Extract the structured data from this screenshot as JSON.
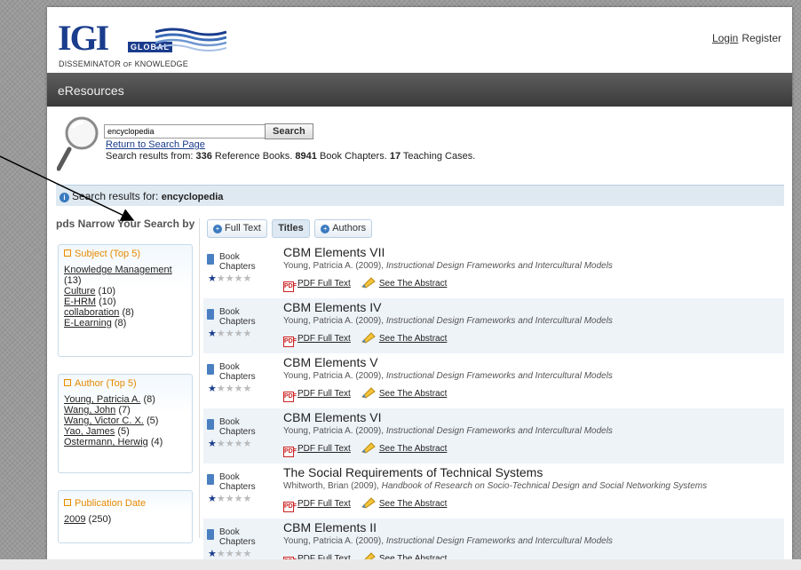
{
  "header": {
    "logo_word": "IGI",
    "logo_global": "GLOBAL",
    "logo_tag_a": "DISSEMINATOR",
    "logo_tag_of": "OF",
    "logo_tag_b": "KNOWLEDGE",
    "login": "Login",
    "register": "Register"
  },
  "nav": {
    "title": "eResources"
  },
  "search": {
    "value": "encyclopedia",
    "button": "Search",
    "return_link": "Return to Search Page",
    "summary_prefix": "Search results from: ",
    "ref_books_count": "336",
    "ref_books_label": " Reference Books. ",
    "chapters_count": "8941",
    "chapters_label": " Book Chapters. ",
    "cases_count": "17",
    "cases_label": " Teaching Cases."
  },
  "results_header": {
    "label": "Search results for: ",
    "term": "encyclopedia"
  },
  "sidebar": {
    "title": "pds Narrow Your Search by",
    "facets": [
      {
        "title": "Subject (Top 5)",
        "items": [
          {
            "link": "Knowledge Management",
            "count": "(13)"
          },
          {
            "link": "Culture",
            "count": "(10)"
          },
          {
            "link": "E-HRM",
            "count": "(10)"
          },
          {
            "link": "collaboration",
            "count": "(8)"
          },
          {
            "link": "E-Learning",
            "count": "(8)"
          }
        ]
      },
      {
        "title": "Author (Top 5)",
        "items": [
          {
            "link": "Young, Patricia A.",
            "count": "(8)"
          },
          {
            "link": "Wang, John",
            "count": "(7)"
          },
          {
            "link": "Wang, Victor C. X.",
            "count": "(5)"
          },
          {
            "link": "Yao, James",
            "count": "(5)"
          },
          {
            "link": "Ostermann, Herwig",
            "count": "(4)"
          }
        ]
      },
      {
        "title": "Publication Date",
        "items": [
          {
            "link": "2009",
            "count": "(250)"
          }
        ]
      }
    ]
  },
  "tabs": [
    {
      "label": "Full Text",
      "icon": "plus-circle-icon"
    },
    {
      "label": "Titles",
      "active": true
    },
    {
      "label": "Authors",
      "icon": "plus-circle-icon"
    }
  ],
  "results": [
    {
      "type": "Book Chapters",
      "rating": 1,
      "title": "CBM Elements VII",
      "cite_author": "Young, Patricia A. (2009), ",
      "cite_source": "Instructional Design Frameworks and Intercultural Models",
      "pdf": "PDF Full Text",
      "abstract": "See The Abstract"
    },
    {
      "type": "Book Chapters",
      "rating": 1,
      "title": "CBM Elements IV",
      "cite_author": "Young, Patricia A. (2009), ",
      "cite_source": "Instructional Design Frameworks and Intercultural Models",
      "pdf": "PDF Full Text",
      "abstract": "See The Abstract"
    },
    {
      "type": "Book Chapters",
      "rating": 1,
      "title": "CBM Elements V",
      "cite_author": "Young, Patricia A. (2009), ",
      "cite_source": "Instructional Design Frameworks and Intercultural Models",
      "pdf": "PDF Full Text",
      "abstract": "See The Abstract"
    },
    {
      "type": "Book Chapters",
      "rating": 1,
      "title": "CBM Elements VI",
      "cite_author": "Young, Patricia A. (2009), ",
      "cite_source": "Instructional Design Frameworks and Intercultural Models",
      "pdf": "PDF Full Text",
      "abstract": "See The Abstract"
    },
    {
      "type": "Book Chapters",
      "rating": 1,
      "title": "The Social Requirements of Technical Systems",
      "cite_author": "Whitworth, Brian (2009), ",
      "cite_source": "Handbook of Research on Socio-Technical Design and Social Networking Systems",
      "pdf": "PDF Full Text",
      "abstract": "See The Abstract"
    },
    {
      "type": "Book Chapters",
      "rating": 1,
      "title": "CBM Elements II",
      "cite_author": "Young, Patricia A. (2009), ",
      "cite_source": "Instructional Design Frameworks and Intercultural Models",
      "pdf": "PDF Full Text",
      "abstract": "See The Abstract"
    }
  ],
  "colors": {
    "brand_blue": "#1a3c8c",
    "facet_orange": "#e68a00",
    "nav_dark": "#3a3a3a",
    "row_alt": "#eef3f8"
  }
}
